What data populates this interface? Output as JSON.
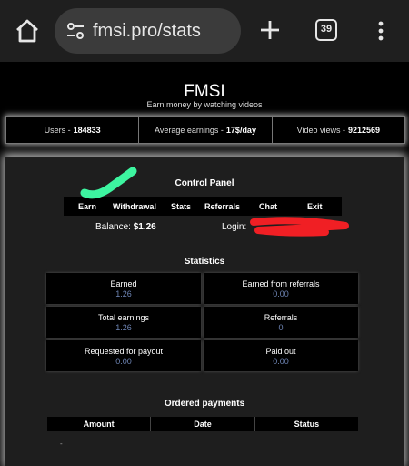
{
  "browser": {
    "url": "fmsi.pro/stats",
    "tab_count": "39",
    "icons": [
      "home-icon",
      "site-settings-icon",
      "new-tab-icon",
      "tabs-icon",
      "more-menu-icon"
    ]
  },
  "site": {
    "brand": "FMSI",
    "tagline": "Earn money by watching videos"
  },
  "stats_strip": [
    {
      "label": "Users - ",
      "value": "184833"
    },
    {
      "label": "Average earnings - ",
      "value": "17$/day"
    },
    {
      "label": "Video views - ",
      "value": "9212569"
    }
  ],
  "control_panel": {
    "title": "Control Panel",
    "nav": [
      "Earn",
      "Withdrawal",
      "Stats",
      "Referrals",
      "Chat",
      "Exit"
    ],
    "balance_label": "Balance: ",
    "balance_value": "$1.26",
    "login_label": "Login:"
  },
  "statistics": {
    "title": "Statistics",
    "cells": [
      {
        "label": "Earned",
        "value": "1.26"
      },
      {
        "label": "Earned from referrals",
        "value": "0.00"
      },
      {
        "label": "Total earnings",
        "value": "1.26"
      },
      {
        "label": "Referrals",
        "value": "0"
      },
      {
        "label": "Requested for payout",
        "value": "0.00"
      },
      {
        "label": "Paid out",
        "value": "0.00"
      }
    ]
  },
  "ordered_payments": {
    "title": "Ordered payments",
    "columns": [
      "Amount",
      "Date",
      "Status"
    ],
    "rows_text": "-"
  },
  "colors": {
    "annotation_green": "#3df5a0",
    "annotation_red": "#f01f24",
    "value_blue": "#6f86b6"
  }
}
